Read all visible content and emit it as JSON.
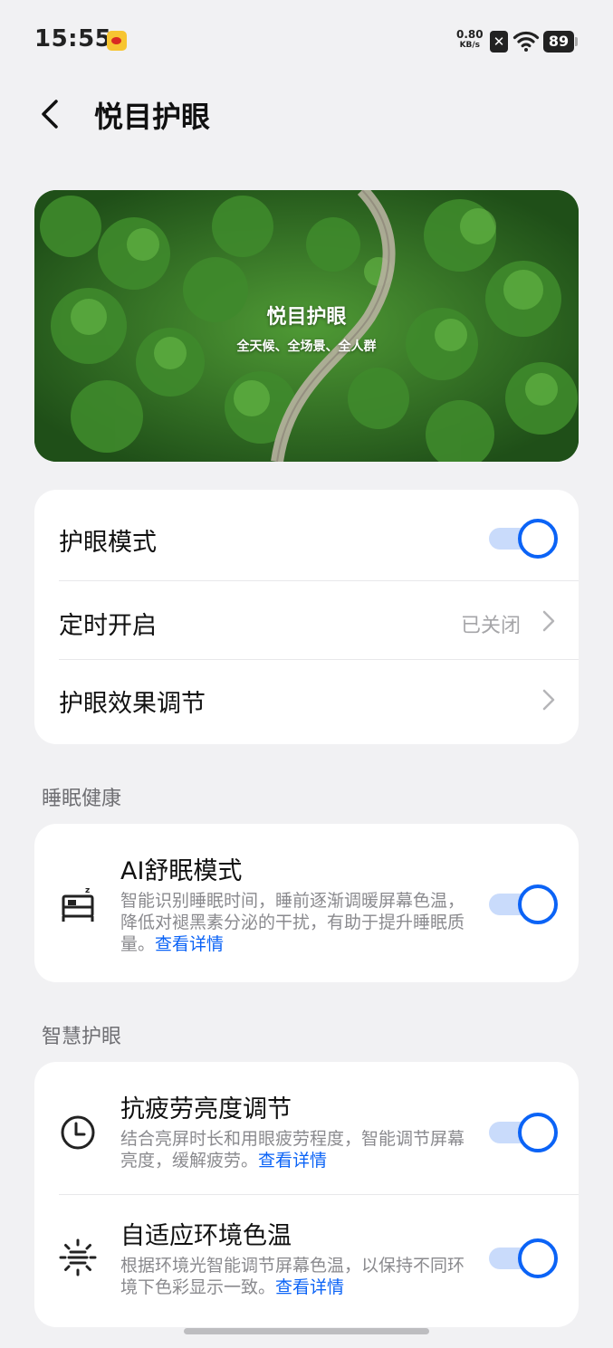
{
  "status_bar": {
    "time": "15:55",
    "net_speed": "0.80",
    "net_speed_unit": "KB/s",
    "battery": "89"
  },
  "header": {
    "title": "悦目护眼"
  },
  "hero": {
    "title": "悦目护眼",
    "subtitle": "全天候、全场景、全人群"
  },
  "settings_card": {
    "eye_mode_label": "护眼模式",
    "eye_mode_on": true,
    "schedule_label": "定时开启",
    "schedule_value": "已关闭",
    "effect_label": "护眼效果调节"
  },
  "sleep_section": {
    "label": "睡眠健康",
    "item": {
      "icon": "bed-icon",
      "title": "AI舒眠模式",
      "desc": "智能识别睡眠时间，睡前逐渐调暖屏幕色温，降低对褪黑素分泌的干扰，有助于提升睡眠质量。",
      "link": "查看详情",
      "on": true
    }
  },
  "smart_section": {
    "label": "智慧护眼",
    "items": [
      {
        "icon": "clock-icon",
        "title": "抗疲劳亮度调节",
        "desc": "结合亮屏时长和用眼疲劳程度，智能调节屏幕亮度，缓解疲劳。",
        "link": "查看详情",
        "on": true
      },
      {
        "icon": "sun-icon",
        "title": "自适应环境色温",
        "desc": "根据环境光智能调节屏幕色温，以保持不同环境下色彩显示一致。",
        "link": "查看详情",
        "on": true
      }
    ]
  },
  "colors": {
    "accent": "#0b63f6",
    "toggle_track": "#c9dbfb",
    "background": "#f1f1f3"
  }
}
